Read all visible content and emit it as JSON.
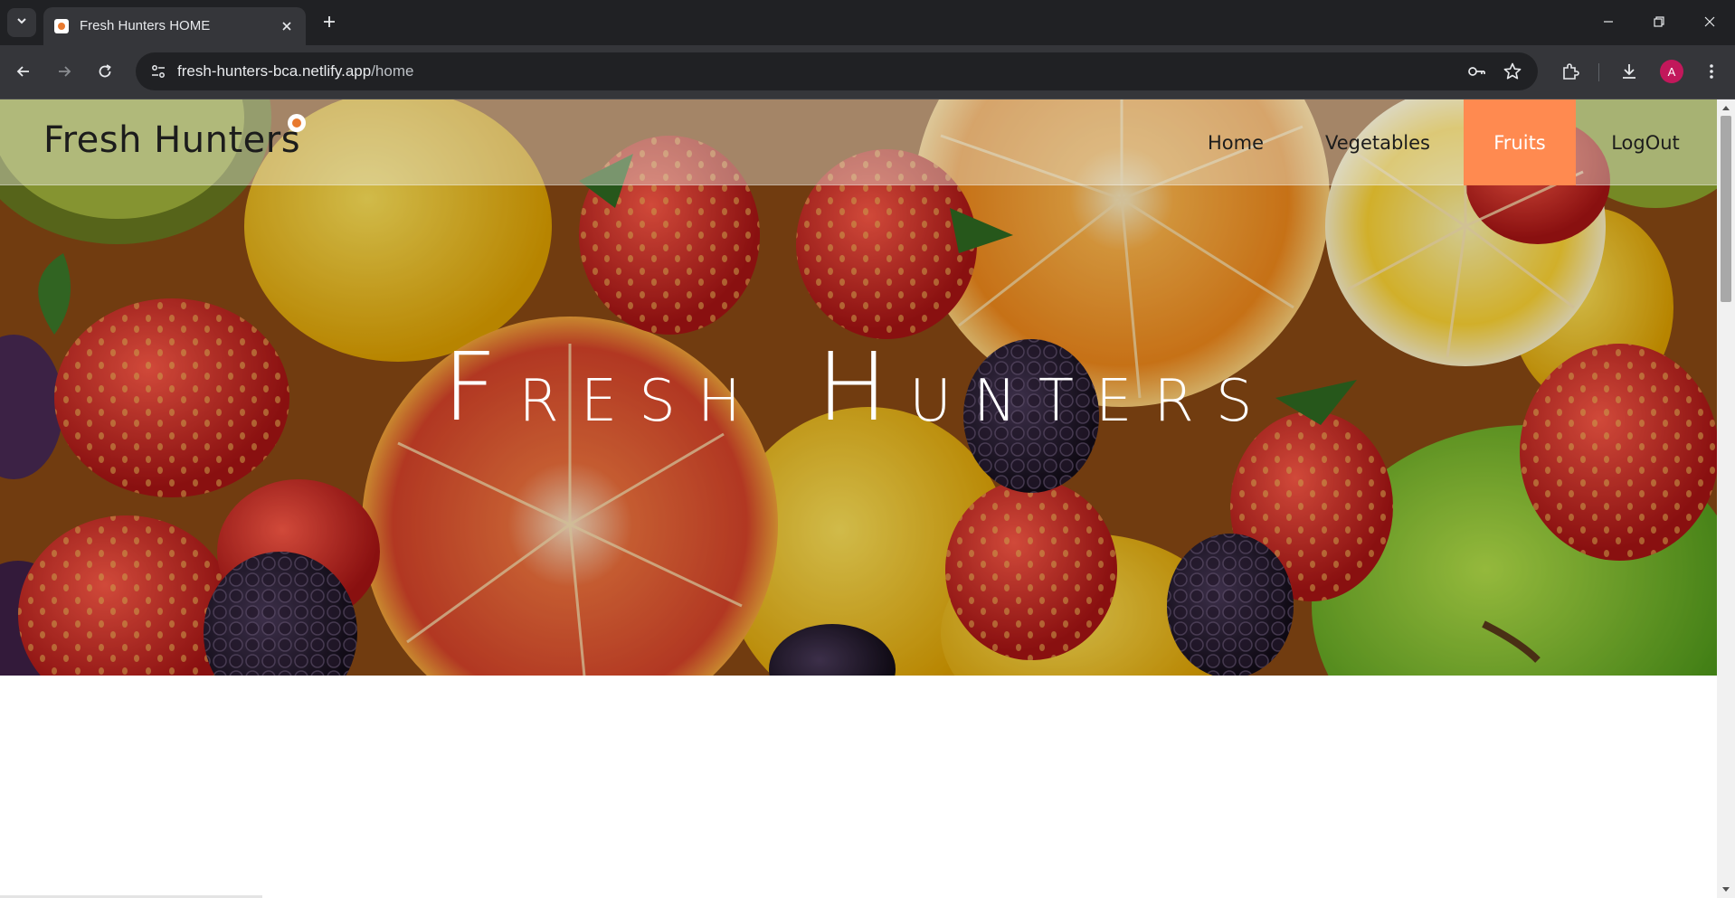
{
  "browser": {
    "tab_title": "Fresh Hunters HOME",
    "url_host": "fresh-hunters-bca.netlify.app",
    "url_path": "/home",
    "profile_initial": "A",
    "icons": [
      "tab-search-icon",
      "close-icon",
      "plus-icon",
      "minimize-icon",
      "restore-icon",
      "window-close-icon",
      "back-icon",
      "forward-icon",
      "reload-icon",
      "site-info-icon",
      "key-icon",
      "star-icon",
      "extensions-icon",
      "download-icon",
      "menu-icon"
    ]
  },
  "site": {
    "brand": "Fresh Hunters",
    "nav": [
      {
        "label": "Home",
        "active": false
      },
      {
        "label": "Vegetables",
        "active": false
      },
      {
        "label": "Fruits",
        "active": true
      },
      {
        "label": "LogOut",
        "active": false
      }
    ],
    "hero": {
      "word1_first": "F",
      "word1_rest": "RESH",
      "word2_first": "H",
      "word2_rest": "UNTERS"
    }
  },
  "colors": {
    "accent": "#ff8a50",
    "chrome_dark": "#202124",
    "chrome_toolbar": "#35363a",
    "avatar": "#c2185b"
  }
}
